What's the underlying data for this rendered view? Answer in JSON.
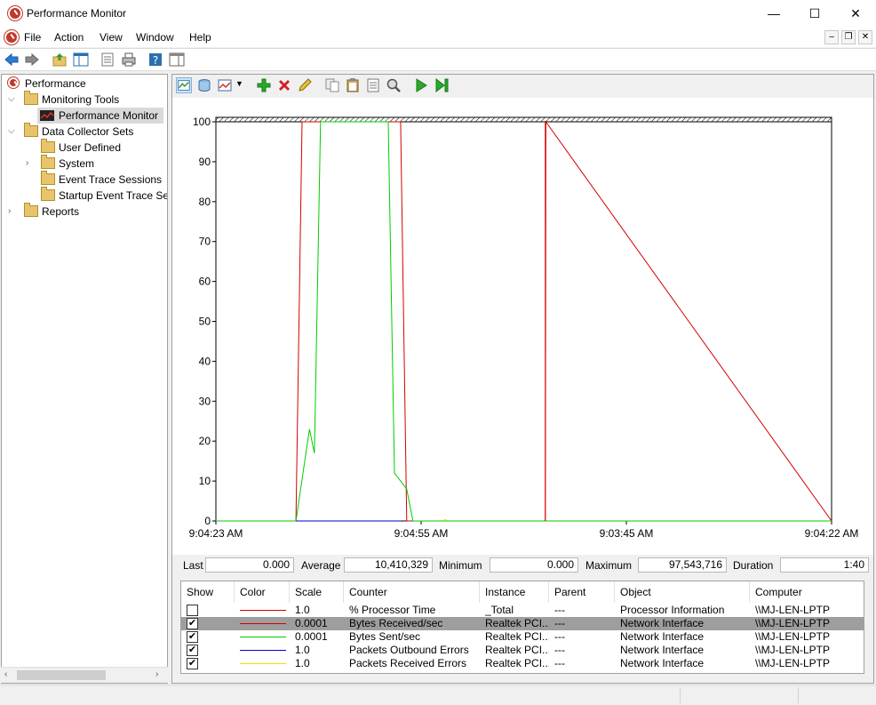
{
  "window": {
    "title": "Performance Monitor",
    "minimize": "—",
    "maximize": "☐",
    "close": "✕"
  },
  "menu": [
    "File",
    "Action",
    "View",
    "Window",
    "Help"
  ],
  "mdi": {
    "minimize": "–",
    "restore": "❐",
    "close": "✕"
  },
  "tree": {
    "root": "Performance",
    "monitoring_tools": "Monitoring Tools",
    "performance_monitor": "Performance Monitor",
    "data_collector_sets": "Data Collector Sets",
    "user_defined": "User Defined",
    "system": "System",
    "event_trace_sessions": "Event Trace Sessions",
    "startup_event_trace": "Startup Event Trace Ses",
    "reports": "Reports"
  },
  "stats": {
    "last_label": "Last",
    "last_value": "0.000",
    "average_label": "Average",
    "average_value": "10,410,329",
    "minimum_label": "Minimum",
    "minimum_value": "0.000",
    "maximum_label": "Maximum",
    "maximum_value": "97,543,716",
    "duration_label": "Duration",
    "duration_value": "1:40"
  },
  "legend": {
    "headers": [
      "Show",
      "Color",
      "Scale",
      "Counter",
      "Instance",
      "Parent",
      "Object",
      "Computer"
    ],
    "rows": [
      {
        "checked": false,
        "color": "#d40000",
        "scale": "1.0",
        "counter": "% Processor Time",
        "instance": "_Total",
        "parent": "---",
        "object": "Processor Information",
        "computer": "\\\\MJ-LEN-LPTP"
      },
      {
        "checked": true,
        "color": "#d40000",
        "scale": "0.0001",
        "counter": "Bytes Received/sec",
        "instance": "Realtek PCI...",
        "parent": "---",
        "object": "Network Interface",
        "computer": "\\\\MJ-LEN-LPTP"
      },
      {
        "checked": true,
        "color": "#00cc00",
        "scale": "0.0001",
        "counter": "Bytes Sent/sec",
        "instance": "Realtek PCI...",
        "parent": "---",
        "object": "Network Interface",
        "computer": "\\\\MJ-LEN-LPTP"
      },
      {
        "checked": true,
        "color": "#0000cc",
        "scale": "1.0",
        "counter": "Packets Outbound Errors",
        "instance": "Realtek PCI...",
        "parent": "---",
        "object": "Network Interface",
        "computer": "\\\\MJ-LEN-LPTP"
      },
      {
        "checked": true,
        "color": "#e6e600",
        "scale": "1.0",
        "counter": "Packets Received Errors",
        "instance": "Realtek PCI...",
        "parent": "---",
        "object": "Network Interface",
        "computer": "\\\\MJ-LEN-LPTP"
      }
    ]
  },
  "chart_data": {
    "type": "line",
    "ylim": [
      0,
      100
    ],
    "yticks": [
      0,
      10,
      20,
      30,
      40,
      50,
      60,
      70,
      80,
      90,
      100
    ],
    "xtick_labels": [
      "9:04:23 AM",
      "9:04:55 AM",
      "9:03:45 AM",
      "9:04:22 AM"
    ],
    "xlim": [
      0,
      100
    ],
    "current_time_marker": 53.5,
    "series": [
      {
        "name": "Bytes Received/sec",
        "color": "#d40000",
        "x": [
          0,
          13,
          14,
          30,
          31,
          53.5,
          53.6,
          100
        ],
        "y": [
          0,
          0,
          100,
          100,
          0,
          0,
          100,
          0
        ]
      },
      {
        "name": "Bytes Sent/sec",
        "color": "#00cc00",
        "x": [
          0,
          13,
          15.2,
          16,
          17,
          28,
          29,
          31,
          32,
          100
        ],
        "y": [
          0,
          0,
          23,
          17,
          100,
          100,
          12,
          8,
          0,
          0
        ]
      },
      {
        "name": "Packets Outbound Errors",
        "color": "#0000cc",
        "x": [
          13,
          30
        ],
        "y": [
          0,
          0
        ]
      },
      {
        "name": "Packets Received Errors",
        "color": "#e6e600",
        "x": [
          37,
          37.5
        ],
        "y": [
          0.3,
          0.3
        ]
      }
    ]
  }
}
